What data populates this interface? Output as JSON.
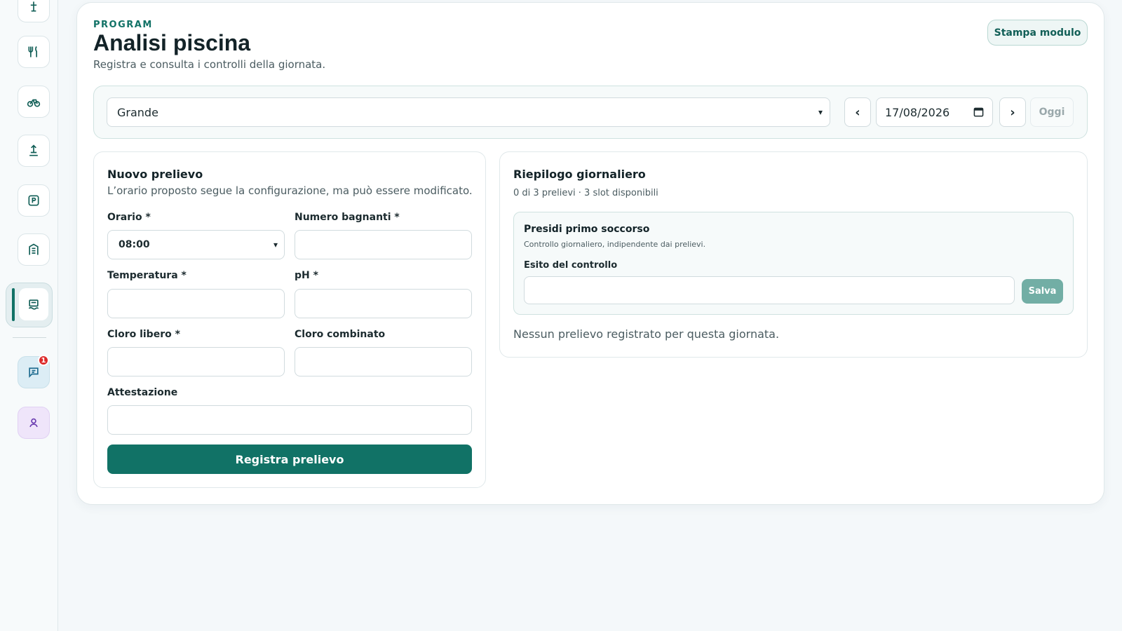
{
  "sidebar": {
    "items": [
      "lifeguard-icon",
      "restaurant-icon",
      "bike-icon",
      "beach-icon",
      "parking-icon",
      "building-icon",
      "pool-icon"
    ],
    "active": "pool-icon",
    "chat_badge": "1"
  },
  "header": {
    "kicker": "PROGRAM",
    "title": "Analisi piscina",
    "subtitle": "Registra e consulta i controlli della giornata.",
    "print_label": "Stampa modulo"
  },
  "filters": {
    "pool_value": "Grande",
    "prev_label": "‹",
    "next_label": "›",
    "date_value": "17/08/2026",
    "today_label": "Oggi"
  },
  "form": {
    "title": "Nuovo prelievo",
    "description": "L’orario proposto segue la configurazione, ma può essere modificato.",
    "time_label": "Orario *",
    "time_value": "08:00",
    "bathers_label": "Numero bagnanti *",
    "temperature_label": "Temperatura *",
    "ph_label": "pH *",
    "free_chlorine_label": "Cloro libero *",
    "combined_chlorine_label": "Cloro combinato",
    "attestation_label": "Attestazione",
    "submit_label": "Registra prelievo"
  },
  "summary": {
    "title": "Riepilogo giornaliero",
    "subtitle": "0 di 3 prelievi · 3 slot disponibili",
    "first_aid_title": "Presidi primo soccorso",
    "first_aid_desc": "Controllo giornaliero, indipendente dai prelievi.",
    "check_label": "Esito del controllo",
    "save_label": "Salva",
    "empty_message": "Nessun prelievo registrato per questa giornata."
  },
  "colors": {
    "accent": "#117266",
    "badge": "#dd2b2b"
  }
}
